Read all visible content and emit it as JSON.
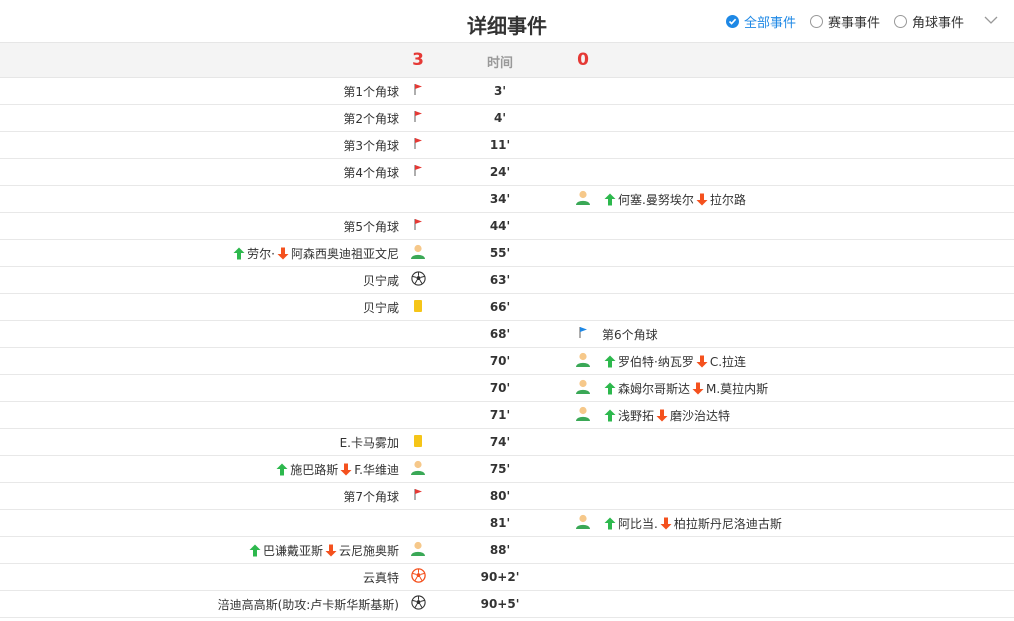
{
  "header": {
    "title": "详细事件",
    "filters": [
      {
        "label": "全部事件",
        "checked": true
      },
      {
        "label": "赛事事件",
        "checked": false
      },
      {
        "label": "角球事件",
        "checked": false
      }
    ]
  },
  "score": {
    "home": "3",
    "time_label": "时间",
    "away": "0"
  },
  "colors": {
    "accent": "#1e88e5",
    "score": "#e53935",
    "in_arrow": "#2db84d",
    "out_arrow": "#f4511e",
    "corner_home": "#e53935",
    "corner_away": "#1e88e5",
    "card": "#f5c518"
  },
  "events": [
    {
      "minute": "3'",
      "home": {
        "type": "corner",
        "text": "第1个角球"
      }
    },
    {
      "minute": "4'",
      "home": {
        "type": "corner",
        "text": "第2个角球"
      }
    },
    {
      "minute": "11'",
      "home": {
        "type": "corner",
        "text": "第3个角球"
      }
    },
    {
      "minute": "24'",
      "home": {
        "type": "corner",
        "text": "第4个角球"
      }
    },
    {
      "minute": "34'",
      "away": {
        "type": "sub",
        "in": "何塞.曼努埃尔",
        "out": "拉尔路"
      }
    },
    {
      "minute": "44'",
      "home": {
        "type": "corner",
        "text": "第5个角球"
      }
    },
    {
      "minute": "55'",
      "home": {
        "type": "sub",
        "in": "劳尔·",
        "out": "阿森西奥迪祖亚文尼"
      }
    },
    {
      "minute": "63'",
      "home": {
        "type": "goal",
        "text": "贝宁咸"
      }
    },
    {
      "minute": "66'",
      "home": {
        "type": "yellow",
        "text": "贝宁咸"
      }
    },
    {
      "minute": "68'",
      "away": {
        "type": "corner",
        "text": "第6个角球"
      }
    },
    {
      "minute": "70'",
      "away": {
        "type": "sub",
        "in": "罗伯特·纳瓦罗",
        "out": "C.拉连"
      }
    },
    {
      "minute": "70'",
      "away": {
        "type": "sub",
        "in": "森姆尔哥斯达",
        "out": "M.莫拉内斯"
      }
    },
    {
      "minute": "71'",
      "away": {
        "type": "sub",
        "in": "浅野拓",
        "out": "磨沙治达特"
      }
    },
    {
      "minute": "74'",
      "home": {
        "type": "yellow",
        "text": "E.卡马雾加"
      }
    },
    {
      "minute": "75'",
      "home": {
        "type": "sub",
        "in": "施巴路斯",
        "out": "F.华维迪"
      }
    },
    {
      "minute": "80'",
      "home": {
        "type": "corner",
        "text": "第7个角球"
      }
    },
    {
      "minute": "81'",
      "away": {
        "type": "sub",
        "in": "阿比当.",
        "out": "柏拉斯丹尼洛迪古斯"
      }
    },
    {
      "minute": "88'",
      "home": {
        "type": "sub",
        "in": "巴谦戴亚斯",
        "out": "云尼施奥斯"
      }
    },
    {
      "minute": "90+2'",
      "home": {
        "type": "penalty-goal",
        "text": "云真特"
      }
    },
    {
      "minute": "90+5'",
      "home": {
        "type": "goal",
        "text": "涪迪高高斯(助攻:卢卡斯华斯基斯)"
      }
    }
  ]
}
